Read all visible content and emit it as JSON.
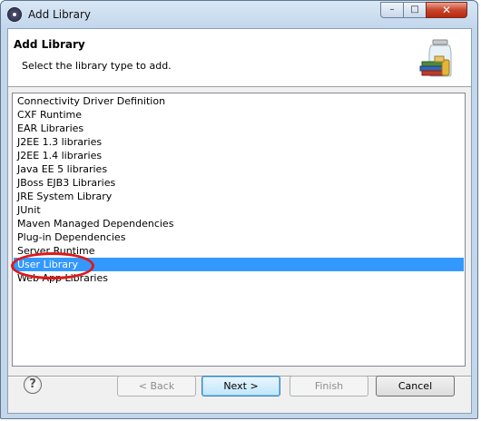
{
  "window": {
    "title": "Add Library",
    "minimize_glyph": "–",
    "maximize_glyph": "□",
    "close_glyph": "✕",
    "app_icon": "eclipse-icon"
  },
  "header": {
    "title": "Add Library",
    "description": "Select the library type to add.",
    "icon": "library-jar-books-icon"
  },
  "library_list": {
    "items": [
      "Connectivity Driver Definition",
      "CXF Runtime",
      "EAR Libraries",
      "J2EE 1.3 libraries",
      "J2EE 1.4 libraries",
      "Java EE 5 libraries",
      "JBoss EJB3 Libraries",
      "JRE System Library",
      "JUnit",
      "Maven Managed Dependencies",
      "Plug-in Dependencies",
      "Server Runtime",
      "User Library",
      "Web App Libraries"
    ],
    "selected_index": 12
  },
  "colors": {
    "selection": "#3399ff",
    "highlight_ring": "#e01818"
  },
  "footer": {
    "help_glyph": "?",
    "back_label": "< Back",
    "next_label": "Next >",
    "finish_label": "Finish",
    "cancel_label": "Cancel"
  }
}
